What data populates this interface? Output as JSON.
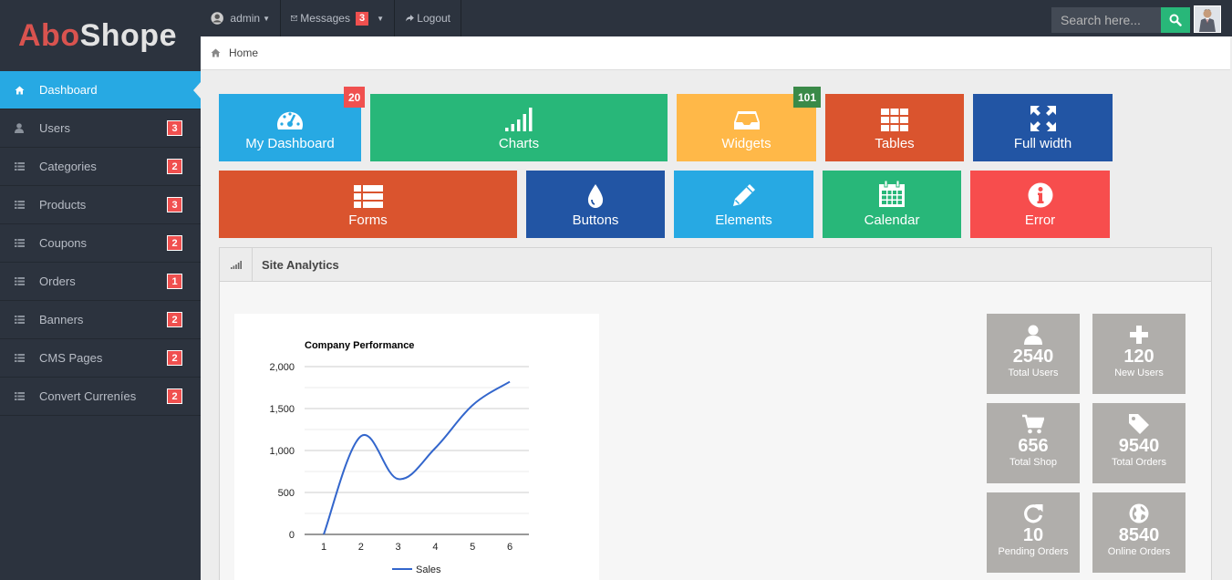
{
  "brand": {
    "part1": "Abo",
    "part2": "Shope"
  },
  "sidebar": {
    "items": [
      {
        "label": "Dashboard",
        "icon": "home-icon",
        "badge": "",
        "active": true
      },
      {
        "label": "Users",
        "icon": "user-icon",
        "badge": "3"
      },
      {
        "label": "Categories",
        "icon": "list-icon",
        "badge": "2"
      },
      {
        "label": "Products",
        "icon": "list-icon",
        "badge": "3"
      },
      {
        "label": "Coupons",
        "icon": "list-icon",
        "badge": "2"
      },
      {
        "label": "Orders",
        "icon": "list-icon",
        "badge": "1"
      },
      {
        "label": "Banners",
        "icon": "list-icon",
        "badge": "2"
      },
      {
        "label": "CMS Pages",
        "icon": "list-icon",
        "badge": "2"
      },
      {
        "label": "Convert Curreníes",
        "icon": "list-icon",
        "badge": "2"
      }
    ]
  },
  "topbar": {
    "user": "admin",
    "messages_label": "Messages",
    "messages_count": "3",
    "logout_label": "Logout",
    "search_placeholder": "Search here..."
  },
  "breadcrumb": {
    "home": "Home"
  },
  "tiles": [
    {
      "label": "My Dashboard",
      "icon": "dashboard-icon",
      "color": "#27a9e3",
      "badge": "20",
      "badge_color": "#f0504f"
    },
    {
      "label": "Charts",
      "icon": "signal-icon",
      "color": "#28b779",
      "badge": ""
    },
    {
      "label": "Widgets",
      "icon": "inbox-icon",
      "color": "#ffb848",
      "badge": "101",
      "badge_color": "#3a8a48"
    },
    {
      "label": "Tables",
      "icon": "grid-icon",
      "color": "#da542e",
      "badge": ""
    },
    {
      "label": "Full width",
      "icon": "fullscreen-icon",
      "color": "#2255a4",
      "badge": ""
    },
    {
      "label": "Forms",
      "icon": "list-icon",
      "color": "#da542e",
      "badge": ""
    },
    {
      "label": "Buttons",
      "icon": "drop-icon",
      "color": "#2255a4",
      "badge": ""
    },
    {
      "label": "Elements",
      "icon": "pencil-icon",
      "color": "#27a9e3",
      "badge": ""
    },
    {
      "label": "Calendar",
      "icon": "calendar-icon",
      "color": "#28b779",
      "badge": ""
    },
    {
      "label": "Error",
      "icon": "info-icon",
      "color": "#f74d4d",
      "badge": ""
    }
  ],
  "analytics": {
    "title": "Site Analytics"
  },
  "stats": [
    {
      "value": "2540",
      "label": "Total Users",
      "icon": "user-icon"
    },
    {
      "value": "120",
      "label": "New Users",
      "icon": "plus-icon"
    },
    {
      "value": "656",
      "label": "Total Shop",
      "icon": "cart-icon"
    },
    {
      "value": "9540",
      "label": "Total Orders",
      "icon": "tag-icon"
    },
    {
      "value": "10",
      "label": "Pending Orders",
      "icon": "refresh-icon"
    },
    {
      "value": "8540",
      "label": "Online Orders",
      "icon": "globe-icon"
    }
  ],
  "chart_data": {
    "type": "line",
    "title": "Company Performance",
    "x": [
      1,
      2,
      3,
      4,
      5,
      6
    ],
    "series": [
      {
        "name": "Sales",
        "values": [
          0,
          1170,
          660,
          1030,
          1540,
          1820
        ],
        "color": "#3366cc"
      }
    ],
    "yticks": [
      "0",
      "500",
      "1,000",
      "1,500",
      "2,000"
    ],
    "xticks": [
      "1",
      "2",
      "3",
      "4",
      "5",
      "6"
    ],
    "ylim": [
      0,
      2000
    ],
    "xlim": [
      1,
      6
    ],
    "grid": true,
    "legend": "bottom"
  }
}
